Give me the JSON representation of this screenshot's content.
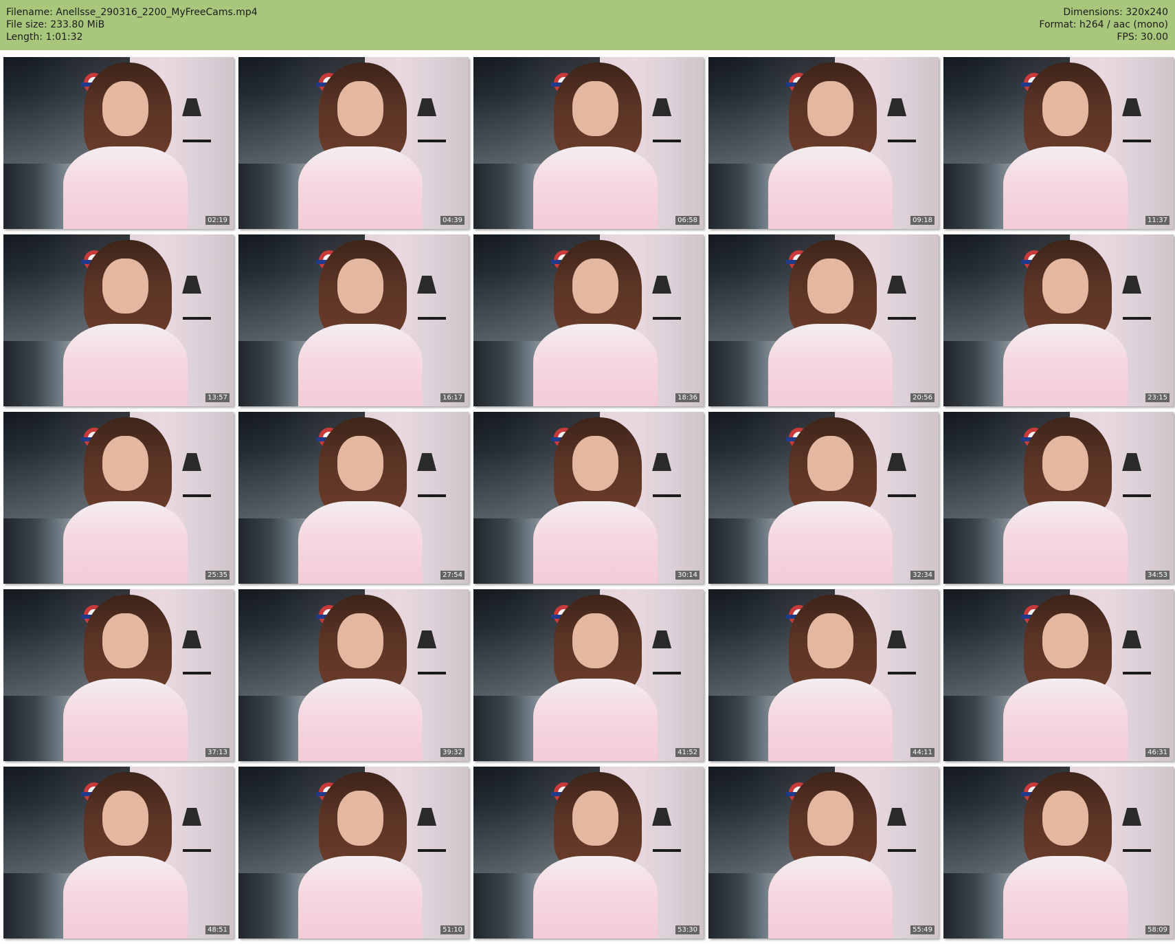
{
  "header": {
    "filename": "Filename: Anellsse_290316_2200_MyFreeCams.mp4",
    "file_size": "File size: 233.80 MiB",
    "length": "Length: 1:01:32",
    "dimensions": "Dimensions: 320x240",
    "format": "Format: h264 / aac (mono)",
    "fps": "FPS: 30.00"
  },
  "thumbnails": [
    {
      "time": "02:19"
    },
    {
      "time": "04:39"
    },
    {
      "time": "06:58"
    },
    {
      "time": "09:18"
    },
    {
      "time": "11:37"
    },
    {
      "time": "13:57"
    },
    {
      "time": "16:17"
    },
    {
      "time": "18:36"
    },
    {
      "time": "20:56"
    },
    {
      "time": "23:15"
    },
    {
      "time": "25:35"
    },
    {
      "time": "27:54"
    },
    {
      "time": "30:14"
    },
    {
      "time": "32:34"
    },
    {
      "time": "34:53"
    },
    {
      "time": "37:13"
    },
    {
      "time": "39:32"
    },
    {
      "time": "41:52"
    },
    {
      "time": "44:11"
    },
    {
      "time": "46:31"
    },
    {
      "time": "48:51"
    },
    {
      "time": "51:10"
    },
    {
      "time": "53:30"
    },
    {
      "time": "55:49"
    },
    {
      "time": "58:09"
    }
  ],
  "colors": {
    "header_bg": "#a9c67d",
    "timestamp_bg": "#5a5a5a"
  }
}
